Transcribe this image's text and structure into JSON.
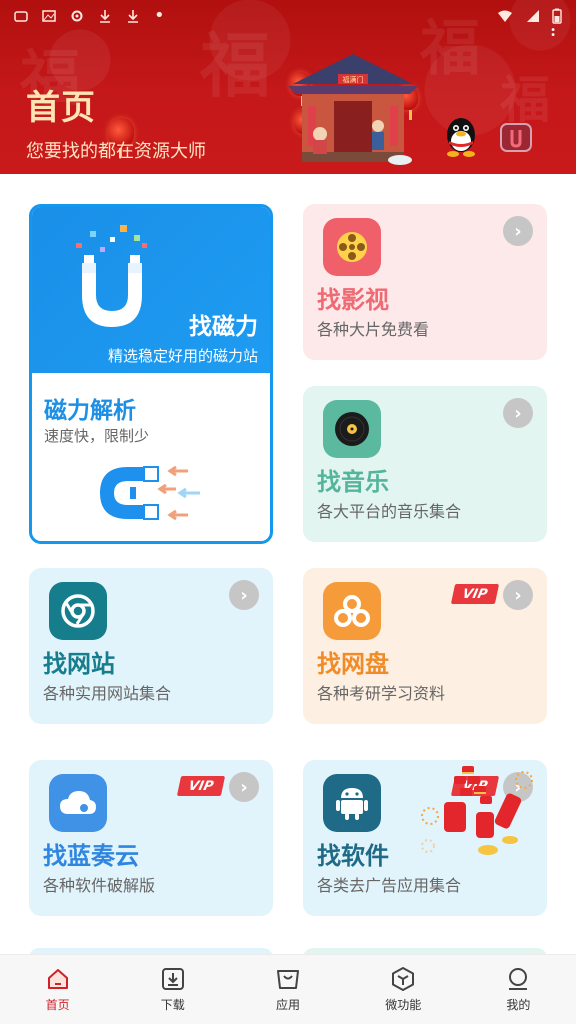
{
  "header": {
    "title": "首页",
    "subtitle": "您要找的都在资源大师",
    "house_sign": "福满门"
  },
  "status_bar": {
    "icons": [
      "notification-icon",
      "image-icon",
      "gear-icon",
      "download-icon",
      "download-icon",
      "dot-icon"
    ],
    "right_icons": [
      "wifi-icon",
      "signal-icon",
      "battery-icon"
    ]
  },
  "colors": {
    "header_red": "#c5181a",
    "title_gold": "#ffe4b5",
    "blue": "#1d8fe4",
    "vip_red": "#e8383d",
    "nav_active": "#d0212a"
  },
  "cards": {
    "magnet": {
      "top_title": "找磁力",
      "top_desc": "精选稳定好用的磁力站",
      "sub_title": "磁力解析",
      "sub_desc": "速度快，限制少"
    },
    "video": {
      "title": "找影视",
      "desc": "各种大片免费看",
      "icon": "film-reel-icon"
    },
    "music": {
      "title": "找音乐",
      "desc": "各大平台的音乐集合",
      "icon": "vinyl-record-icon"
    },
    "website": {
      "title": "找网站",
      "desc": "各种实用网站集合",
      "icon": "chrome-icon"
    },
    "netdisk": {
      "title": "找网盘",
      "desc": "各种考研学习资料",
      "icon": "cloud-disk-icon",
      "badge": "VIP"
    },
    "lanzou": {
      "title": "找蓝奏云",
      "desc": "各种软件破解版",
      "icon": "cloud-icon",
      "badge": "VIP"
    },
    "software": {
      "title": "找软件",
      "desc": "各类去广告应用集合",
      "icon": "android-icon",
      "badge": "VIP"
    }
  },
  "bottom_nav": [
    {
      "label": "首页",
      "icon": "home-icon",
      "active": true
    },
    {
      "label": "下载",
      "icon": "download-icon",
      "active": false
    },
    {
      "label": "应用",
      "icon": "bag-icon",
      "active": false
    },
    {
      "label": "微功能",
      "icon": "cube-icon",
      "active": false
    },
    {
      "label": "我的",
      "icon": "user-icon",
      "active": false
    }
  ]
}
